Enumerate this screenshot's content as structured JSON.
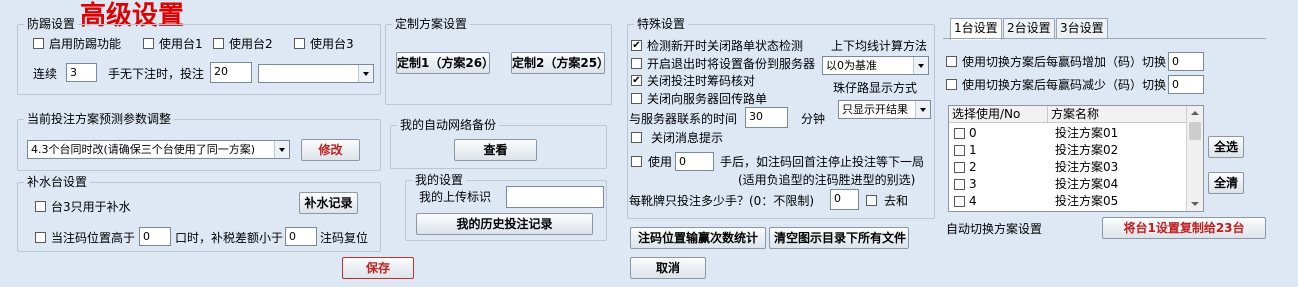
{
  "title_overlay": "高级设置",
  "colors": {
    "background": "#dde8f4",
    "accent_red": "#e00000",
    "button_red_text": "#c02020"
  },
  "fangtan": {
    "title": "防踢设置",
    "enable_label": "启用防踢功能",
    "use1": "使用台1",
    "use2": "使用台2",
    "use3": "使用台3",
    "lianxu": "连续",
    "lianxu_value": "3",
    "hand_label": "手无下注时，投注",
    "hand_value": "20",
    "select_value": ""
  },
  "custom": {
    "title": "定制方案设置",
    "btn1": "定制1（方案26）",
    "btn2": "定制2（方案25）"
  },
  "predict": {
    "title": "当前投注方案预测参数调整",
    "select_value": "4.3个台同时改(请确保三个台使用了同一方案)",
    "modify": "修改"
  },
  "backup": {
    "title": "我的自动网络备份",
    "view": "查看"
  },
  "bushui": {
    "title": "补水台设置",
    "only_tai3": "台3只用于补水",
    "record": "补水记录",
    "pos_label": "当注码位置高于",
    "pos_value": "0",
    "kou_label": "口时，补税差额小于",
    "kou_value": "0",
    "reset": "注码复位"
  },
  "mine": {
    "title": "我的设置",
    "upload_label": "我的上传标识",
    "upload_value": "",
    "history": "我的历史投注记录"
  },
  "special": {
    "title": "特殊设置",
    "c1": "检测新开时关闭路单状态检测",
    "c2": "开启退出时将设置备份到服务器",
    "c3": "关闭投注时筹码核对",
    "c4": "关闭向服务器回传路单",
    "avg_label": "上下均线计算方法",
    "avg_value": "以0为基准",
    "zai_label": "珠仔路显示方式",
    "zai_value": "只显示开结果",
    "server_label": "与服务器联系的时间",
    "server_value": "30",
    "minute": "分钟",
    "c5": "关闭消息提示",
    "use_label": "使用",
    "use_value": "0",
    "hand_after": "手后，如注码回首注停止投注等下一局",
    "hint": "(适用负追型的注码胜进型的别选)",
    "max_label": "每靴牌只投注多少手？(0：不限制)",
    "max_value": "0",
    "he": "去和"
  },
  "tabs": [
    "1台设置",
    "2台设置",
    "3台设置"
  ],
  "tai": {
    "inc_label": "使用切换方案后每赢码增加（码）切换",
    "inc_value": "0",
    "dec_label": "使用切换方案后每赢码减少（码）切换",
    "dec_value": "0",
    "col1": "选择使用/No",
    "col2": "方案名称",
    "rows": [
      {
        "no": "0",
        "name": "投注方案01"
      },
      {
        "no": "1",
        "name": "投注方案02"
      },
      {
        "no": "2",
        "name": "投注方案03"
      },
      {
        "no": "3",
        "name": "投注方案04"
      },
      {
        "no": "4",
        "name": "投注方案05"
      }
    ],
    "select_all": "全选",
    "clear_all": "全清",
    "auto_switch": "自动切换方案设置",
    "copy": "将台1设置复制给23台"
  },
  "bottom": {
    "save": "保存",
    "cancel": "取消",
    "stats": "注码位置输赢次数统计",
    "clear_dir": "清空图示目录下所有文件"
  }
}
